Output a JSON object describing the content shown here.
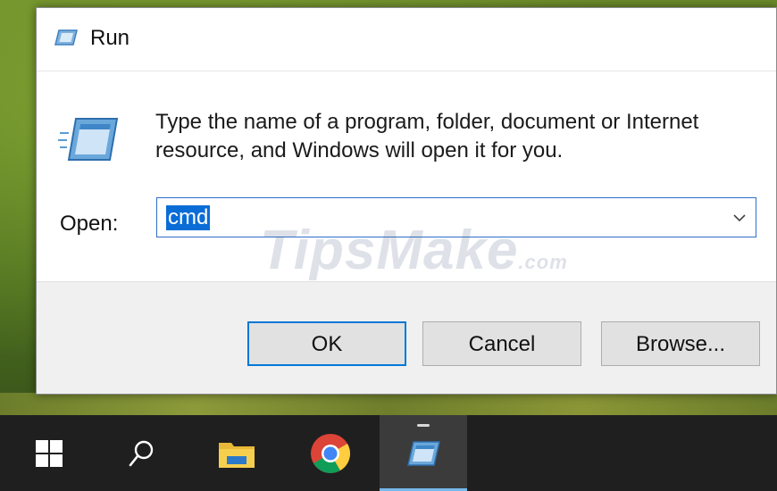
{
  "window": {
    "title": "Run"
  },
  "dialog": {
    "description": "Type the name of a program, folder, document or Internet resource, and Windows will open it for you.",
    "open_label": "Open:",
    "open_value": "cmd"
  },
  "buttons": {
    "ok": "OK",
    "cancel": "Cancel",
    "browse": "Browse..."
  },
  "watermark": {
    "main": "TipsMake",
    "suffix": ".com"
  },
  "taskbar": {
    "items": [
      {
        "icon": "windows-start-icon"
      },
      {
        "icon": "search-icon"
      },
      {
        "icon": "file-explorer-icon"
      },
      {
        "icon": "chrome-icon"
      },
      {
        "icon": "run-icon",
        "active": true
      }
    ]
  },
  "colors": {
    "accent": "#0078d7",
    "selection": "#0a6dd6",
    "taskbar": "#1f1f1f",
    "footer": "#f0f0f0"
  }
}
